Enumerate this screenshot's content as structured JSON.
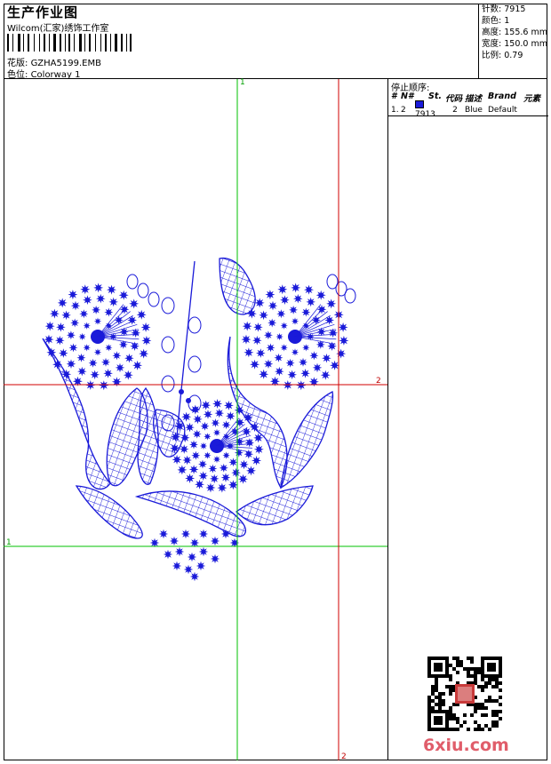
{
  "header": {
    "title": "生产作业图",
    "company": "Wilcom(汇家)绣饰工作室",
    "design_label": "花版:",
    "design_value": "GZHA5199.EMB",
    "colorway_label": "色位:",
    "colorway_value": "Colorway 1"
  },
  "stats": [
    {
      "label": "针数:",
      "value": "7915"
    },
    {
      "label": "颜色:",
      "value": "1"
    },
    {
      "label": "高度:",
      "value": "155.6 mm"
    },
    {
      "label": "宽度:",
      "value": "150.0 mm"
    },
    {
      "label": "比例:",
      "value": "0.79"
    }
  ],
  "stop_sequence": {
    "title": "停止顺序:",
    "headers": [
      "#",
      "N#",
      "St.",
      "代码",
      "描述",
      "Brand",
      "元素"
    ],
    "rows": [
      {
        "idx": "1.",
        "n": "2",
        "st": "7913",
        "code": "2",
        "desc": "Blue",
        "brand": "Default",
        "element": "",
        "color": "#1a1ad9"
      }
    ]
  },
  "guides": {
    "green_top": "1",
    "green_left": "1",
    "red_right": "2",
    "red_bottom": "2"
  },
  "colors": {
    "thread": "#1a1ad9",
    "green": "#00c000",
    "red": "#d00000"
  },
  "watermark": "6xiu.com"
}
